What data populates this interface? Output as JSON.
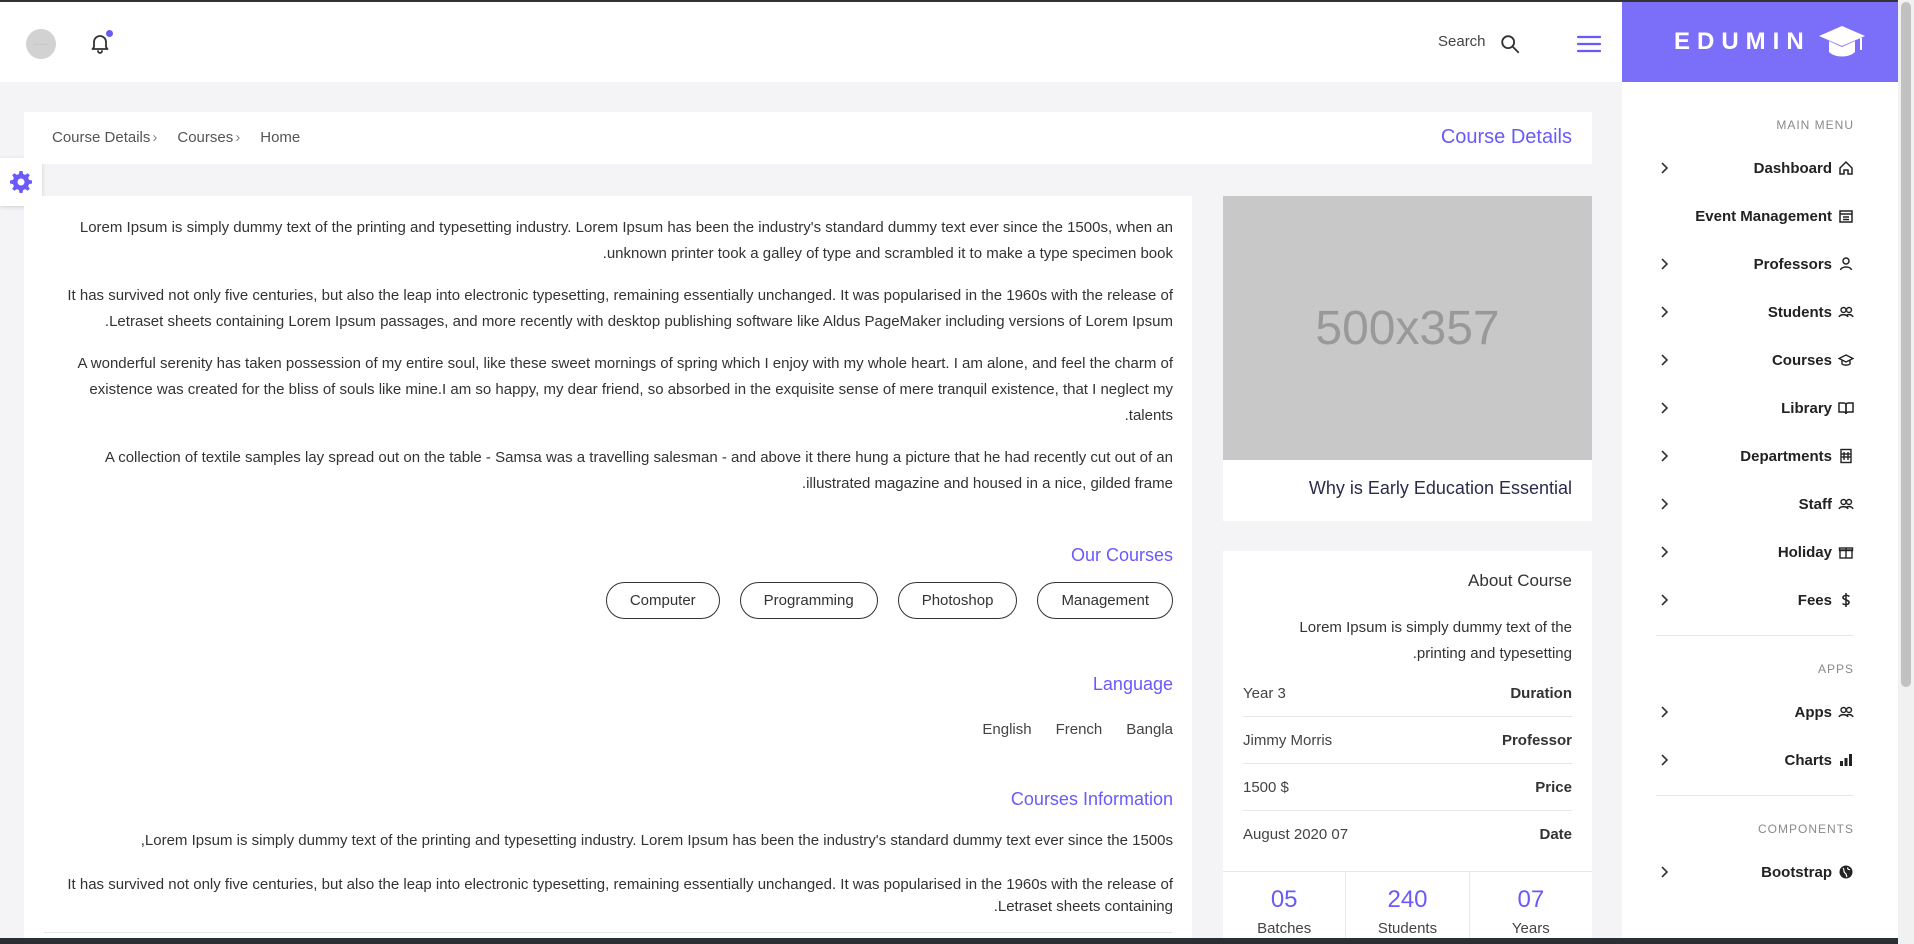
{
  "brand": {
    "name": "EDUMIN",
    "color": "#7b6ef8",
    "accent": "#6a5af9"
  },
  "topbar": {
    "avatar_text": "-----",
    "search_label": "Search"
  },
  "breadcrumb": {
    "items": [
      "Course Details",
      "Courses",
      "Home"
    ],
    "page_title": "Course Details"
  },
  "main": {
    "paragraphs": [
      "Lorem Ipsum is simply dummy text of the printing and typesetting industry. Lorem Ipsum has been the industry's standard dummy text ever since the 1500s, when an unknown printer took a galley of type and scrambled it to make a type specimen book.",
      "It has survived not only five centuries, but also the leap into electronic typesetting, remaining essentially unchanged. It was popularised in the 1960s with the release of Letraset sheets containing Lorem Ipsum passages, and more recently with desktop publishing software like Aldus PageMaker including versions of Lorem Ipsum.",
      "A wonderful serenity has taken possession of my entire soul, like these sweet mornings of spring which I enjoy with my whole heart. I am alone, and feel the charm of existence was created for the bliss of souls like mine.I am so happy, my dear friend, so absorbed in the exquisite sense of mere tranquil existence, that I neglect my talents.",
      "A collection of textile samples lay spread out on the table - Samsa was a travelling salesman - and above it there hung a picture that he had recently cut out of an illustrated magazine and housed in a nice, gilded frame."
    ],
    "our_courses_title": "Our Courses",
    "course_tags": [
      "Computer",
      "Programming",
      "Photoshop",
      "Management"
    ],
    "language_title": "Language",
    "languages": [
      "Bangla",
      "French",
      "English"
    ],
    "info_title": "Courses Information",
    "info_paragraphs": [
      "Lorem Ipsum is simply dummy text of the printing and typesetting industry. Lorem Ipsum has been the industry's standard dummy text ever since the 1500s,",
      "It has survived not only five centuries, but also the leap into electronic typesetting, remaining essentially unchanged. It was popularised in the 1960s with the release of Letraset sheets containing."
    ]
  },
  "image_card": {
    "placeholder": "500x357",
    "title": "Why is Early Education Essential"
  },
  "about": {
    "title": "About Course",
    "text": "Lorem Ipsum is simply dummy text of the printing and typesetting.",
    "rows": [
      {
        "key": "Duration",
        "value": "Year 3"
      },
      {
        "key": "Professor",
        "value": "Jimmy Morris"
      },
      {
        "key": "Price",
        "value": "1500 $"
      },
      {
        "key": "Date",
        "value": "August 2020 07"
      }
    ],
    "stats": [
      {
        "num": "05",
        "label": "Batches"
      },
      {
        "num": "240",
        "label": "Students"
      },
      {
        "num": "07",
        "label": "Years"
      }
    ]
  },
  "sidebar": {
    "main_menu_title": "MAIN MENU",
    "items": [
      {
        "label": "Dashboard",
        "icon": "home-icon"
      },
      {
        "label": "Event Management",
        "icon": "calendar-icon"
      },
      {
        "label": "Professors",
        "icon": "user-icon"
      },
      {
        "label": "Students",
        "icon": "users-icon"
      },
      {
        "label": "Courses",
        "icon": "graduation-cap-icon"
      },
      {
        "label": "Library",
        "icon": "book-icon"
      },
      {
        "label": "Departments",
        "icon": "building-icon"
      },
      {
        "label": "Staff",
        "icon": "users-icon"
      },
      {
        "label": "Holiday",
        "icon": "gift-icon"
      },
      {
        "label": "Fees",
        "icon": "dollar-icon"
      }
    ],
    "apps_title": "APPS",
    "apps_items": [
      {
        "label": "Apps",
        "icon": "users-icon"
      },
      {
        "label": "Charts",
        "icon": "bar-chart-icon"
      }
    ],
    "components_title": "COMPONENTS",
    "components_items": [
      {
        "label": "Bootstrap",
        "icon": "globe-icon"
      }
    ]
  }
}
